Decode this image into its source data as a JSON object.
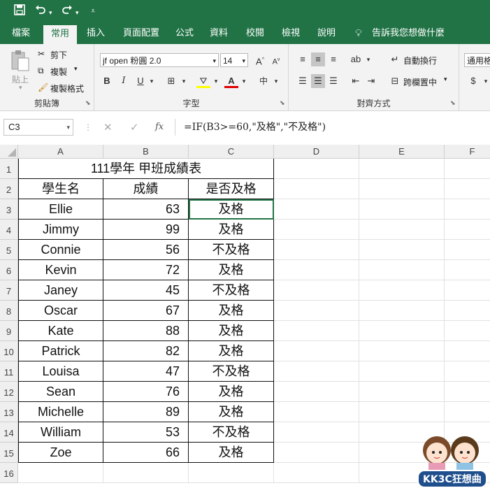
{
  "qat": {
    "save_icon": "floppy-disk",
    "undo_icon": "undo-arrow",
    "redo_icon": "redo-arrow"
  },
  "tabs": [
    "檔案",
    "常用",
    "插入",
    "頁面配置",
    "公式",
    "資料",
    "校閱",
    "檢視",
    "說明"
  ],
  "tell_me": "告訴我您想做什麼",
  "ribbon": {
    "clipboard": {
      "paste": "貼上",
      "cut": "剪下",
      "copy": "複製",
      "format_painter": "複製格式",
      "label": "剪貼簿"
    },
    "font": {
      "font_name": "jf open 粉圓 2.0",
      "font_size": "14",
      "label": "字型"
    },
    "alignment": {
      "wrap_text": "自動換行",
      "merge_center": "跨欄置中",
      "label": "對齊方式"
    },
    "number": {
      "format": "通用格"
    }
  },
  "formula_bar": {
    "name_box": "C3",
    "formula": "=IF(B3>=60,\"及格\",\"不及格\")",
    "fx": "fx"
  },
  "columns": [
    "A",
    "B",
    "C",
    "D",
    "E",
    "F"
  ],
  "rows": [
    "1",
    "2",
    "3",
    "4",
    "5",
    "6",
    "7",
    "8",
    "9",
    "10",
    "11",
    "12",
    "13",
    "14",
    "15",
    "16"
  ],
  "sheet": {
    "title": "111學年 甲班成績表",
    "headers": [
      "學生名",
      "成績",
      "是否及格"
    ],
    "records": [
      [
        "Ellie",
        "63",
        "及格"
      ],
      [
        "Jimmy",
        "99",
        "及格"
      ],
      [
        "Connie",
        "56",
        "不及格"
      ],
      [
        "Kevin",
        "72",
        "及格"
      ],
      [
        "Janey",
        "45",
        "不及格"
      ],
      [
        "Oscar",
        "67",
        "及格"
      ],
      [
        "Kate",
        "88",
        "及格"
      ],
      [
        "Patrick",
        "82",
        "及格"
      ],
      [
        "Louisa",
        "47",
        "不及格"
      ],
      [
        "Sean",
        "76",
        "及格"
      ],
      [
        "Michelle",
        "89",
        "及格"
      ],
      [
        "William",
        "53",
        "不及格"
      ],
      [
        "Zoe",
        "66",
        "及格"
      ]
    ]
  },
  "watermark": "KK3C狂想曲",
  "colors": {
    "excel_green": "#217346"
  }
}
